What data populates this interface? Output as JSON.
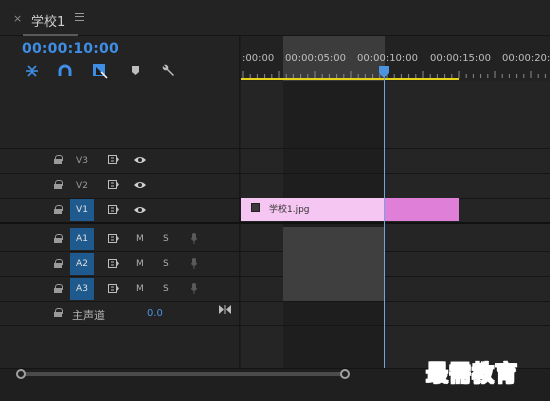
{
  "tab": {
    "close": "×",
    "title": "学校1"
  },
  "timecode": "00:00:10:00",
  "tools": [
    "snap-icon",
    "linked-selection-icon",
    "add-marker-icon",
    "marker-icon",
    "wrench-icon"
  ],
  "ruler": {
    "labels": [
      ":00:00",
      "00:00:05:00",
      "00:00:10:00",
      "00:00:15:00",
      "00:00:20:0"
    ]
  },
  "tracks": {
    "video": [
      {
        "label": "V3",
        "active": false
      },
      {
        "label": "V2",
        "active": false
      },
      {
        "label": "V1",
        "active": true
      }
    ],
    "audio": [
      {
        "label": "A1",
        "m": "M",
        "s": "S"
      },
      {
        "label": "A2",
        "m": "M",
        "s": "S"
      },
      {
        "label": "A3",
        "m": "M",
        "s": "S"
      }
    ],
    "master": {
      "label": "主声道",
      "value": "0.0"
    }
  },
  "clip": {
    "name": "学校1.jpg"
  },
  "watermark": "最需教育",
  "colors": {
    "timecode": "#3f8ee6",
    "work_area": "#e6d21a",
    "clip": "#f6c6f2",
    "clip_selected": "#df7fd8",
    "track_target": "#1f5a8e"
  }
}
